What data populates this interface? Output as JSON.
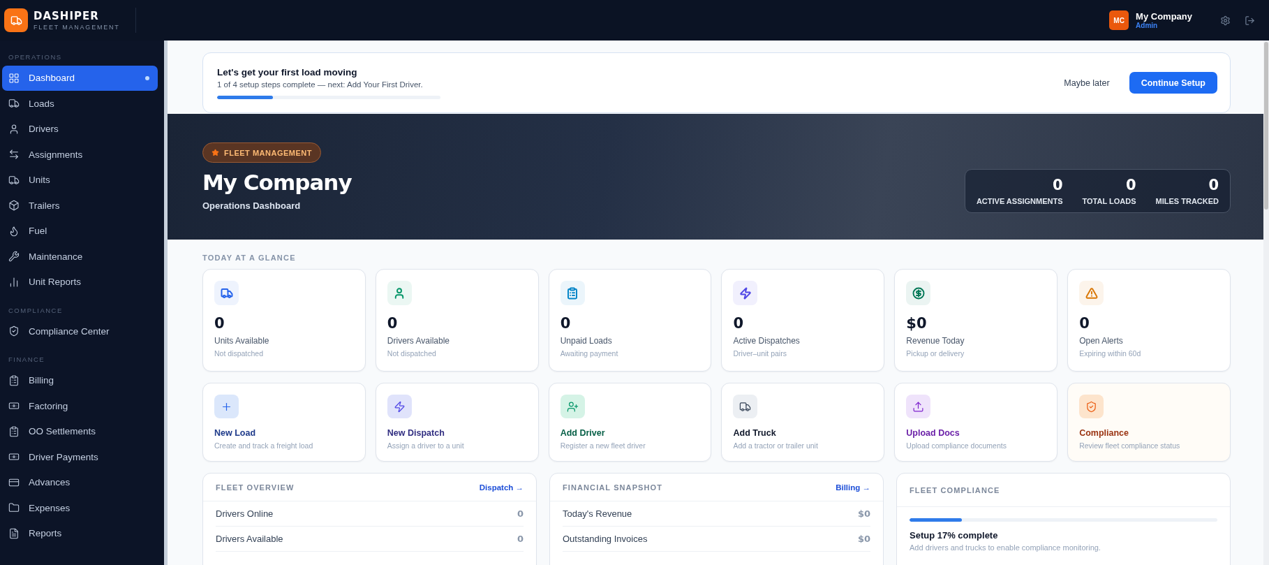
{
  "header": {
    "brand": "DASHIPER",
    "tagline": "FLEET MANAGEMENT",
    "avatar_initials": "MC",
    "company": "My Company",
    "role": "Admin"
  },
  "sidebar": {
    "sections": [
      {
        "title": "OPERATIONS",
        "items": [
          {
            "label": "Dashboard",
            "selected": true
          },
          {
            "label": "Loads",
            "selected": false
          },
          {
            "label": "Drivers",
            "selected": false
          },
          {
            "label": "Assignments",
            "selected": false
          },
          {
            "label": "Units",
            "selected": false
          },
          {
            "label": "Trailers",
            "selected": false
          },
          {
            "label": "Fuel",
            "selected": false
          },
          {
            "label": "Maintenance",
            "selected": false
          },
          {
            "label": "Unit Reports",
            "selected": false
          }
        ]
      },
      {
        "title": "COMPLIANCE",
        "items": [
          {
            "label": "Compliance Center",
            "selected": false
          }
        ]
      },
      {
        "title": "FINANCE",
        "items": [
          {
            "label": "Billing",
            "selected": false
          },
          {
            "label": "Factoring",
            "selected": false
          },
          {
            "label": "OO Settlements",
            "selected": false
          },
          {
            "label": "Driver Payments",
            "selected": false
          },
          {
            "label": "Advances",
            "selected": false
          },
          {
            "label": "Expenses",
            "selected": false
          },
          {
            "label": "Reports",
            "selected": false
          }
        ]
      }
    ]
  },
  "setup": {
    "title": "Let's get your first load moving",
    "subtitle": "1 of 4 setup steps complete — next: Add Your First Driver.",
    "level": 0.25,
    "secondary_button": "Maybe later",
    "primary_button": "Continue Setup"
  },
  "hero": {
    "badge": "FLEET MANAGEMENT",
    "title": "My Company",
    "subtitle": "Operations Dashboard",
    "stats": [
      {
        "value": "0",
        "label": "ACTIVE ASSIGNMENTS"
      },
      {
        "value": "0",
        "label": "TOTAL LOADS"
      },
      {
        "value": "0",
        "label": "MILES TRACKED"
      }
    ]
  },
  "glance": {
    "heading": "TODAY AT A GLANCE",
    "stats": [
      {
        "value": "0",
        "label": "Units Available",
        "note": "Not dispatched",
        "color": "#2563eb"
      },
      {
        "value": "0",
        "label": "Drivers Available",
        "note": "Not dispatched",
        "color": "#059669"
      },
      {
        "value": "0",
        "label": "Unpaid Loads",
        "note": "Awaiting payment",
        "color": "#0284c7"
      },
      {
        "value": "0",
        "label": "Active Dispatches",
        "note": "Driver–unit pairs",
        "color": "#4f46e5"
      },
      {
        "value": "$0",
        "label": "Revenue Today",
        "note": "Pickup or delivery",
        "color": "#047857"
      },
      {
        "value": "0",
        "label": "Open Alerts",
        "note": "Expiring within 60d",
        "color": "#d97706"
      }
    ]
  },
  "actions": [
    {
      "title": "New Load",
      "note": "Create and track a freight load",
      "color": "#1e3a8a"
    },
    {
      "title": "New Dispatch",
      "note": "Assign a driver to a unit",
      "color": "#312e81"
    },
    {
      "title": "Add Driver",
      "note": "Register a new fleet driver",
      "color": "#065f46"
    },
    {
      "title": "Add Truck",
      "note": "Add a tractor or trailer unit",
      "color": "#0f172a"
    },
    {
      "title": "Upload Docs",
      "note": "Upload compliance documents",
      "color": "#6b21a8"
    },
    {
      "title": "Compliance",
      "note": "Review fleet compliance status",
      "color": "#9a3412"
    }
  ],
  "panels": {
    "fleet_overview": {
      "title": "FLEET OVERVIEW",
      "link": "Dispatch →",
      "rows": [
        {
          "label": "Drivers Online",
          "value": "0"
        },
        {
          "label": "Drivers Available",
          "value": "0"
        }
      ]
    },
    "financial_snapshot": {
      "title": "FINANCIAL SNAPSHOT",
      "link": "Billing →",
      "rows": [
        {
          "label": "Today's Revenue",
          "value": "$0"
        },
        {
          "label": "Outstanding Invoices",
          "value": "$0"
        }
      ]
    },
    "fleet_compliance": {
      "title": "FLEET COMPLIANCE",
      "level": 0.17,
      "headline": "Setup 17% complete",
      "note": "Add drivers and trucks to enable compliance monitoring."
    }
  }
}
